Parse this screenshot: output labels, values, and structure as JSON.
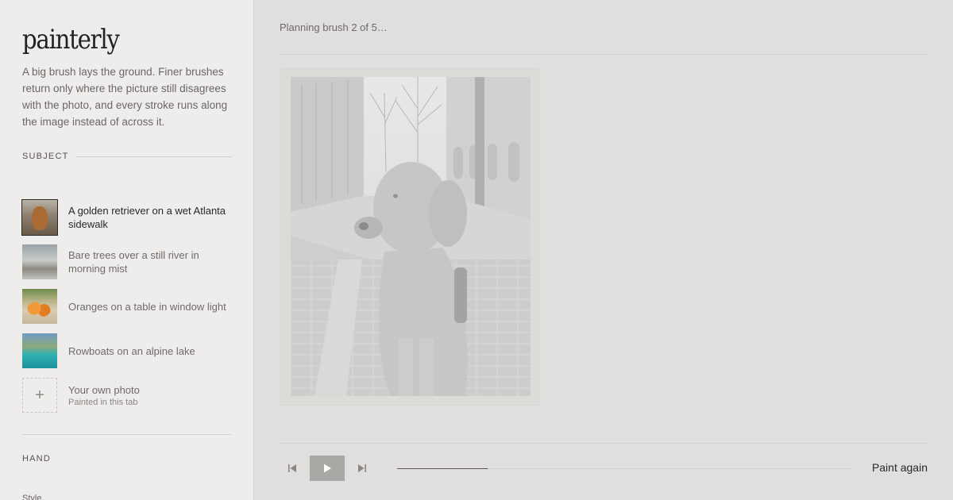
{
  "app": {
    "name": "painterly",
    "description": "A big brush lays the ground. Finer brushes return only where the picture still disagrees with the photo, and every stroke runs along the image instead of across it."
  },
  "sidebar": {
    "subject_heading": "SUBJECT",
    "subjects": [
      {
        "label": "A golden retriever on a wet Atlanta sidewalk",
        "icon": "dog-photo-thumbnail",
        "active": true
      },
      {
        "label": "Bare trees over a still river in morning mist",
        "icon": "river-photo-thumbnail",
        "active": false
      },
      {
        "label": "Oranges on a table in window light",
        "icon": "oranges-photo-thumbnail",
        "active": false
      },
      {
        "label": "Rowboats on an alpine lake",
        "icon": "lake-photo-thumbnail",
        "active": false
      }
    ],
    "upload": {
      "label": "Your own photo",
      "sublabel": "Painted in this tab",
      "icon": "plus-icon"
    },
    "hand_heading": "HAND",
    "style_label": "Style"
  },
  "main": {
    "status": "Planning brush 2 of 5…",
    "canvas_subject": "golden retriever on sidewalk (grayscale underpainting)",
    "progress": 0.2,
    "paint_again_label": "Paint again",
    "controls": {
      "back_icon": "skip-back-icon",
      "play_icon": "play-icon",
      "forward_icon": "skip-forward-icon"
    }
  },
  "colors": {
    "sidebar_bg": "#eeedeb",
    "main_bg": "#e0dfdd",
    "text_dark": "#2a2826",
    "text_muted": "#6e6b67",
    "play_button": "#a9a8a5"
  }
}
